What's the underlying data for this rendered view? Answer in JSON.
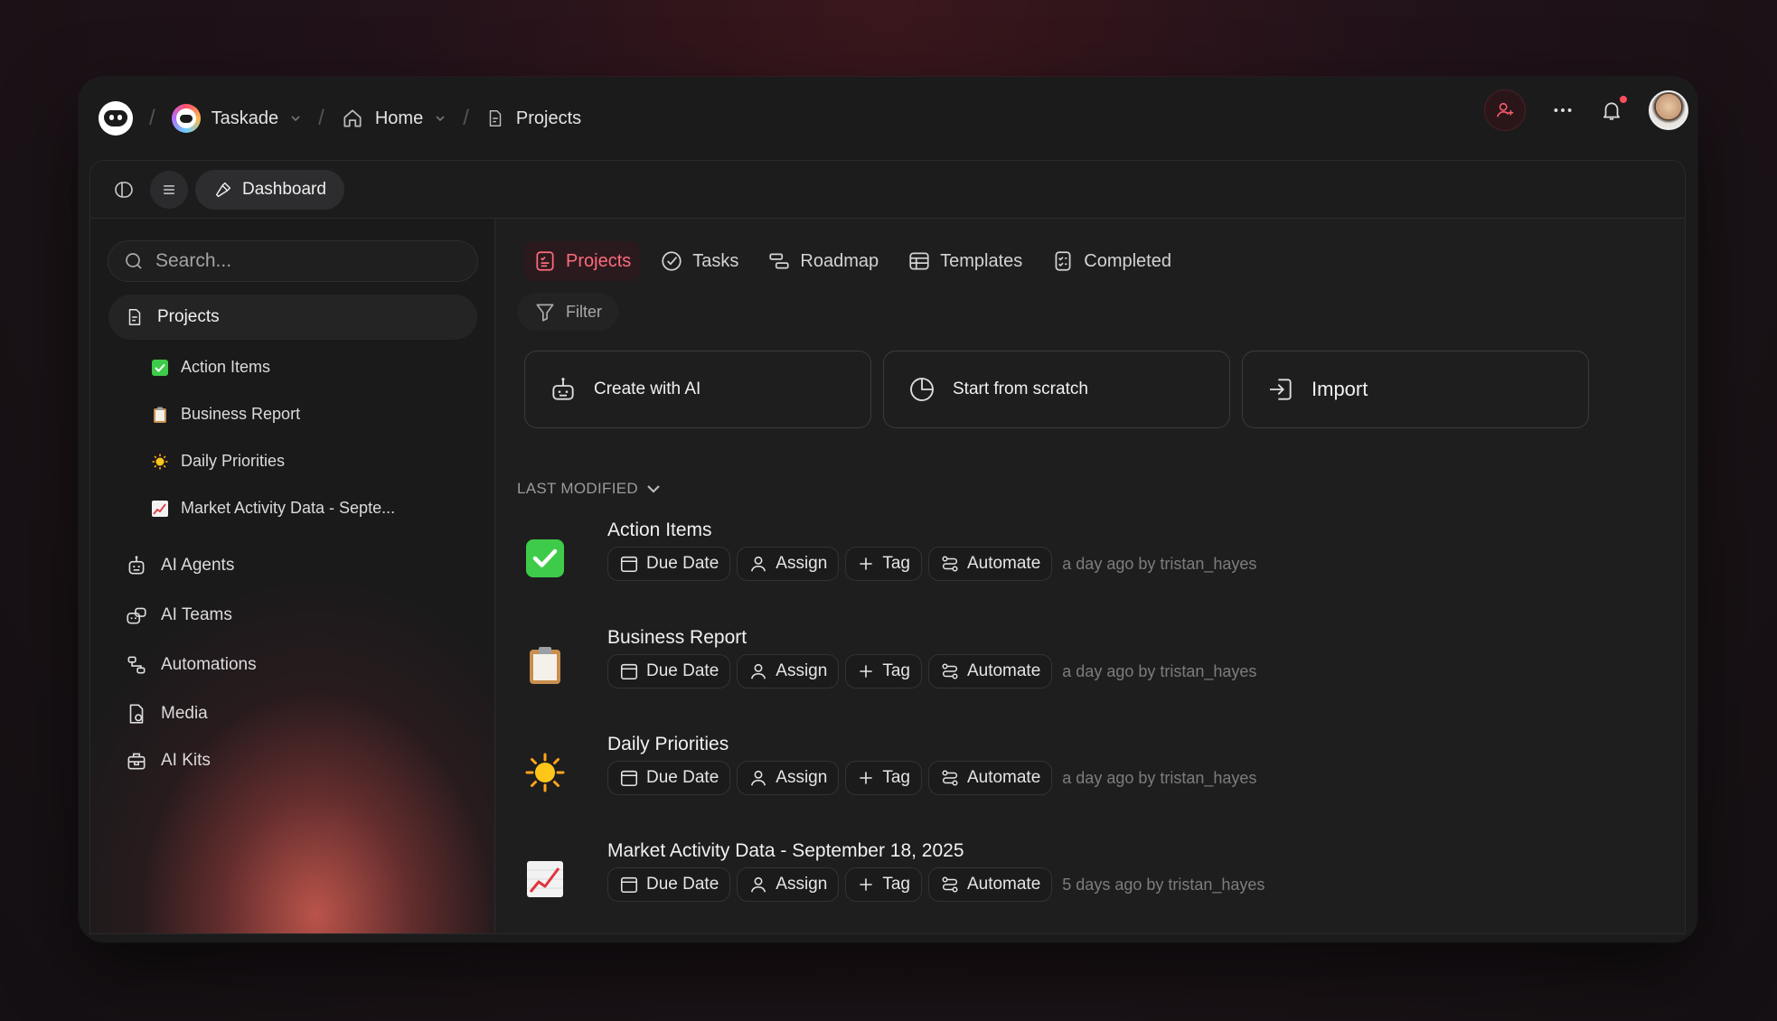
{
  "breadcrumb": {
    "workspace": "Taskade",
    "home": "Home",
    "current": "Projects",
    "separator": "/"
  },
  "toolbar": {
    "dashboard_label": "Dashboard"
  },
  "sidebar": {
    "search_placeholder": "Search...",
    "projects_label": "Projects",
    "project_items": [
      {
        "label": "Action Items",
        "icon": "check-mark-button"
      },
      {
        "label": "Business Report",
        "icon": "clipboard"
      },
      {
        "label": "Daily Priorities",
        "icon": "sun"
      },
      {
        "label": "Market Activity Data - Septe...",
        "icon": "chart-increasing"
      }
    ],
    "nav_items": [
      {
        "label": "AI Agents",
        "icon": "robot-icon"
      },
      {
        "label": "AI Teams",
        "icon": "team-icon"
      },
      {
        "label": "Automations",
        "icon": "flow-icon"
      },
      {
        "label": "Media",
        "icon": "media-icon"
      },
      {
        "label": "AI Kits",
        "icon": "kit-icon"
      }
    ]
  },
  "tabs": [
    {
      "label": "Projects",
      "active": true
    },
    {
      "label": "Tasks",
      "active": false
    },
    {
      "label": "Roadmap",
      "active": false
    },
    {
      "label": "Templates",
      "active": false
    },
    {
      "label": "Completed",
      "active": false
    }
  ],
  "filter_label": "Filter",
  "cards": [
    {
      "label": "Create with AI"
    },
    {
      "label": "Start from scratch"
    },
    {
      "label": "Import"
    }
  ],
  "sort_label": "LAST MODIFIED",
  "chip_labels": {
    "due_date": "Due Date",
    "assign": "Assign",
    "tag": "Tag",
    "automate": "Automate"
  },
  "projects": [
    {
      "title": "Action Items",
      "meta": "a day ago by tristan_hayes",
      "icon": "check-mark-button"
    },
    {
      "title": "Business Report",
      "meta": "a day ago by tristan_hayes",
      "icon": "clipboard"
    },
    {
      "title": "Daily Priorities",
      "meta": "a day ago by tristan_hayes",
      "icon": "sun"
    },
    {
      "title": "Market Activity Data - September 18, 2025",
      "meta": "5 days ago by tristan_hayes",
      "icon": "chart-increasing"
    }
  ],
  "colors": {
    "accent": "#ff6b7c",
    "notification_dot": "#ff4d5e",
    "check_green": "#3ecb4a"
  }
}
